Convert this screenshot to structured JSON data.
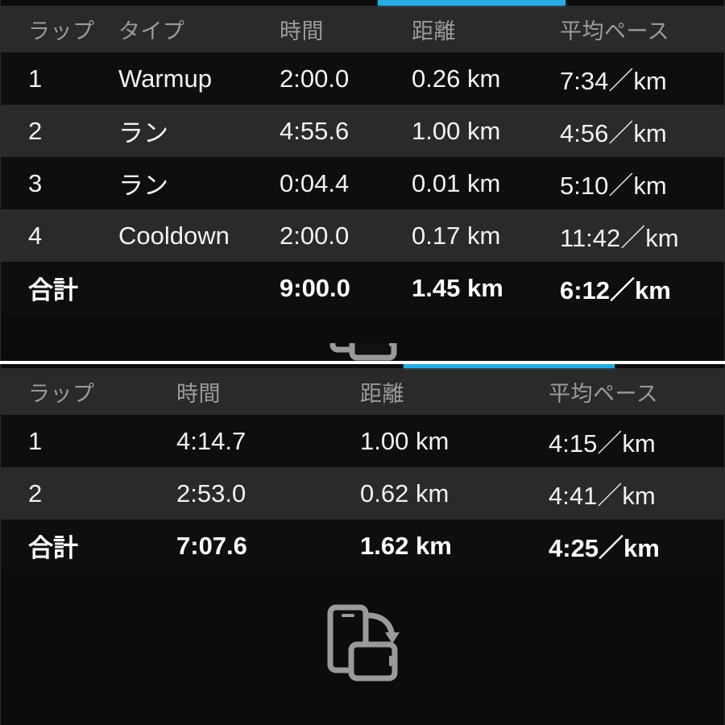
{
  "theme": {
    "accent_color": "#29abe2",
    "panel_background": "#0c0c0c",
    "row_dark": "#0e0e0e",
    "row_light": "#2a2a2a",
    "header_background": "#2a2a2a",
    "header_text_color": "#9a9a9a",
    "body_text_color": "#f2f2f2",
    "divider_color": "#ffffff",
    "icon_color": "#9a9a9a"
  },
  "panel_top": {
    "name": "lap-splits-table-workout",
    "columns": [
      "ラップ",
      "タイプ",
      "時間",
      "距離",
      "平均ペース"
    ],
    "rows": [
      {
        "lap": "1",
        "type": "Warmup",
        "time": "2:00.0",
        "distance": "0.26 km",
        "pace": "7:34／km"
      },
      {
        "lap": "2",
        "type": "ラン",
        "time": "4:55.6",
        "distance": "1.00 km",
        "pace": "4:56／km"
      },
      {
        "lap": "3",
        "type": "ラン",
        "time": "0:04.4",
        "distance": "0.01 km",
        "pace": "5:10／km"
      },
      {
        "lap": "4",
        "type": "Cooldown",
        "time": "2:00.0",
        "distance": "0.17 km",
        "pace": "11:42／km"
      }
    ],
    "total": {
      "lap": "合計",
      "type": "",
      "time": "9:00.0",
      "distance": "1.45 km",
      "pace": "6:12／km"
    }
  },
  "panel_bottom": {
    "name": "lap-splits-table-run",
    "columns": [
      "ラップ",
      "時間",
      "距離",
      "平均ペース"
    ],
    "rows": [
      {
        "lap": "1",
        "time": "4:14.7",
        "distance": "1.00 km",
        "pace": "4:15／km"
      },
      {
        "lap": "2",
        "time": "2:53.0",
        "distance": "0.62 km",
        "pace": "4:41／km"
      }
    ],
    "total": {
      "lap": "合計",
      "time": "7:07.6",
      "distance": "1.62 km",
      "pace": "4:25／km"
    }
  },
  "icons": {
    "rotate_device": "rotate-device-icon"
  }
}
